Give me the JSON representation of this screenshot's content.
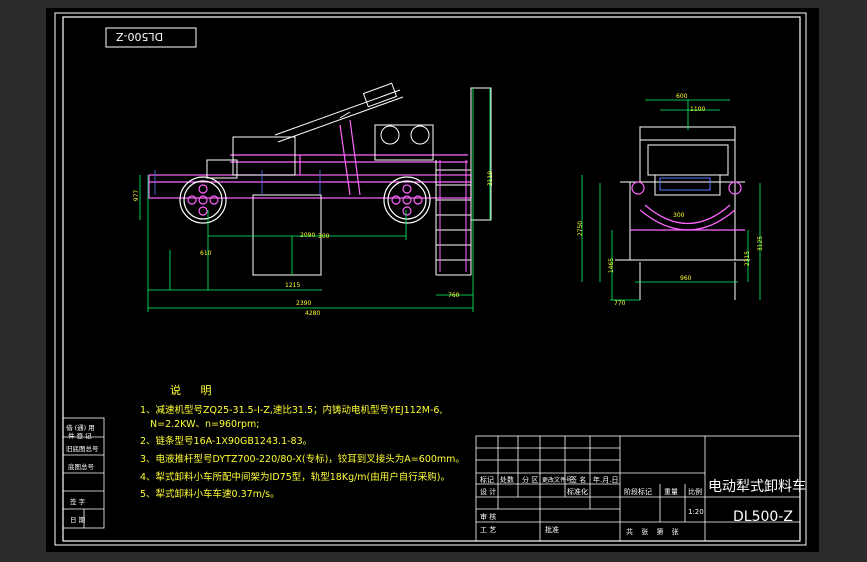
{
  "drawing_stamp": "DL500-Z",
  "notes": {
    "title": "说 明",
    "items": [
      "1、减速机型号ZQ25-31.5-I-Z,速比31.5；内铸动电机型号YEJ112M-6,",
      "N=2.2KW、n=960rpm;",
      "2、链条型号16A-1X90GB1243.1-83。",
      "3、电液推杆型号DYTZ700-220/80-X(专标)，铰耳到叉接头为A=600mm。",
      "4、犁式卸料小车所配中间架为ID75型，轨型18Kg/m(由用户自行采购)。",
      "5、犁式卸料小车车速0.37m/s。"
    ]
  },
  "title_block": {
    "name": "电动犁式卸料车",
    "code": "DL500-Z",
    "scale": "1:20",
    "labels": {
      "mark": "标记",
      "count": "处数",
      "zone": "分 区",
      "change_doc": "更改文件号",
      "sign": "签 名",
      "date": "年.月.日",
      "design": "设 计",
      "standard": "标准化",
      "review": "审 核",
      "process": "工 艺",
      "approve": "批准",
      "stage_mark": "阶段标记",
      "weight": "重量",
      "scale_label": "比例",
      "sheets": "共 张 第 张"
    }
  },
  "side_table": {
    "rows": [
      "借 (通) 用",
      "件 登 记",
      "旧底图总号",
      "底图总号",
      "签 字",
      "日 期"
    ]
  },
  "dimensions": {
    "front": [
      "3119",
      "977",
      "2390",
      "4280",
      "760",
      "2090",
      "1215",
      "300",
      "610"
    ],
    "side": [
      "600",
      "2750",
      "1465",
      "2315",
      "3125",
      "960",
      "770",
      "300",
      "1100"
    ]
  },
  "colors": {
    "outline": "#ffffff",
    "machine": "#ff66ff",
    "dimension": "#00ff66",
    "text": "#ffff33",
    "blue": "#5577ff"
  }
}
